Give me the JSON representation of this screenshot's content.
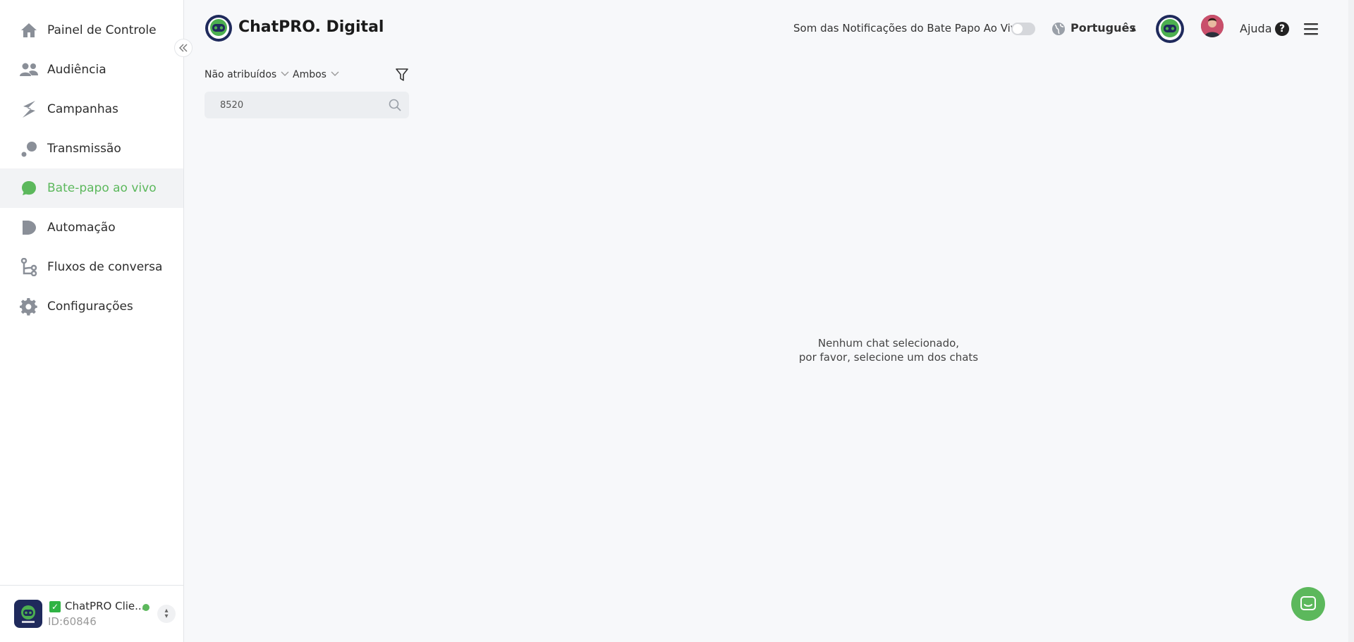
{
  "sidebar": {
    "items": [
      {
        "label": "Painel de Controle",
        "icon": "home-icon"
      },
      {
        "label": "Audiência",
        "icon": "users-icon"
      },
      {
        "label": "Campanhas",
        "icon": "campaigns-icon"
      },
      {
        "label": "Transmissão",
        "icon": "broadcast-icon"
      },
      {
        "label": "Bate-papo ao vivo",
        "icon": "chat-icon",
        "active": true
      },
      {
        "label": "Automação",
        "icon": "automation-icon"
      },
      {
        "label": "Fluxos de conversa",
        "icon": "flow-icon"
      },
      {
        "label": "Configurações",
        "icon": "gear-icon"
      }
    ],
    "workspace": {
      "name": "ChatPRO Clie...",
      "id": "ID:60846"
    }
  },
  "header": {
    "brand": "ChatPRO. Digital",
    "notification_label": "Som das Notificações do Bate Papo Ao Vivo",
    "language": "Português",
    "help": "Ajuda"
  },
  "filters": {
    "assignment": "Não atribuídos",
    "channel": "Ambos",
    "search_value": "8520"
  },
  "empty_state": {
    "line1": "Nenhum chat selecionado,",
    "line2": "por favor, selecione um dos chats"
  },
  "colors": {
    "accent": "#5cb85c",
    "sidebar_active_bg": "#f2f3f5",
    "icon_gray": "#8a8f98"
  }
}
